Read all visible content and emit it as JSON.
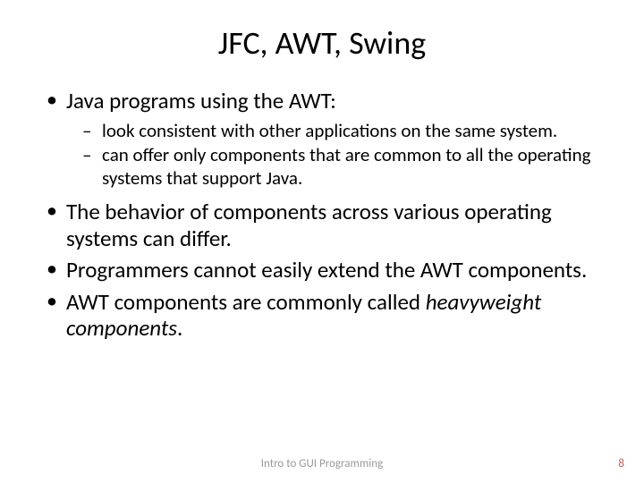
{
  "title": "JFC, AWT, Swing",
  "bullets": {
    "b1": "Java programs using the AWT:",
    "b1_sub1": "look consistent with other applications on the same system.",
    "b1_sub2": "can offer only components that are common to all the operating systems that support Java.",
    "b2": "The behavior of components across various operating systems can differ.",
    "b3": "Programmers cannot easily extend the AWT components.",
    "b4_a": "AWT components are commonly called ",
    "b4_b": "heavyweight components",
    "b4_c": "."
  },
  "footer": {
    "text": "Intro to GUI Programming",
    "page": "8"
  }
}
